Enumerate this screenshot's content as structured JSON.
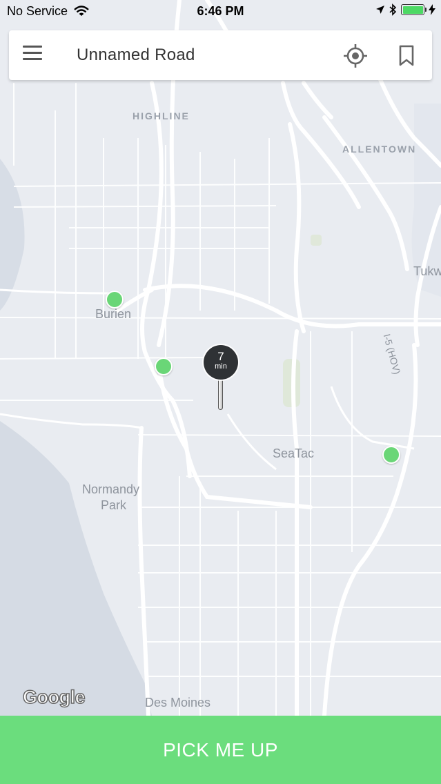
{
  "status_bar": {
    "carrier": "No Service",
    "time": "6:46 PM",
    "battery_level": 1.0,
    "battery_color": "#4cd964"
  },
  "search": {
    "location_text": "Unnamed Road",
    "menu_icon": "hamburger-menu-icon",
    "locate_icon": "crosshair-locate-icon",
    "bookmark_icon": "bookmark-icon"
  },
  "map": {
    "labels": {
      "highline": "HIGHLINE",
      "allentown": "ALLENTOWN",
      "tukwila": "Tukw",
      "burien": "Burien",
      "i5": "I-5 (HOV)",
      "seatac": "SeaTac",
      "normandy_1": "Normandy",
      "normandy_2": "Park",
      "des_moines": "Des Moines"
    },
    "google_logo": "Google",
    "driver_color": "#6ad677",
    "water_color": "#d5dbe4",
    "land_color": "#e9ecf1"
  },
  "pickup_pin": {
    "eta_value": "7",
    "eta_unit": "min"
  },
  "cta": {
    "label": "PICK ME UP",
    "color": "#6bdd7d"
  }
}
